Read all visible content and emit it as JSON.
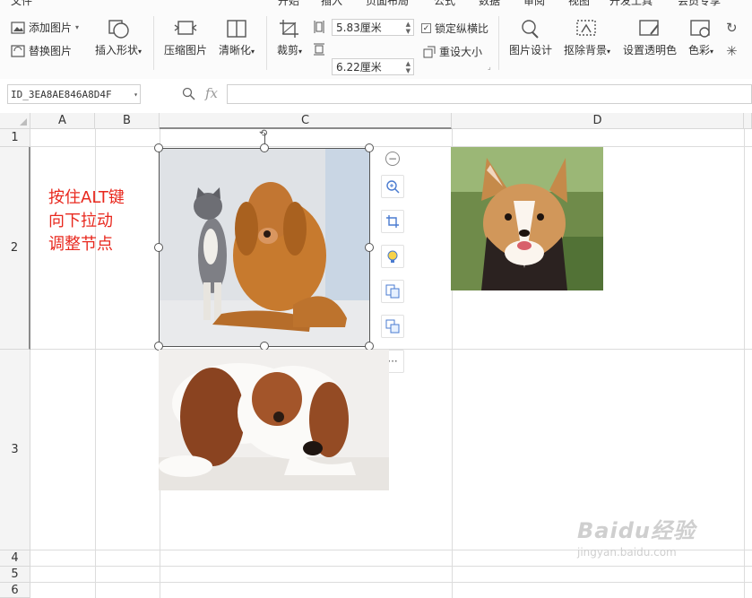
{
  "ribbon": {
    "tabs": [
      "文件",
      "开始",
      "插入",
      "页面布局",
      "公式",
      "数据",
      "审阅",
      "视图",
      "开发工具",
      "会员专享"
    ],
    "add_image": "添加图片",
    "replace_image": "替换图片",
    "insert_shape": "插入形状",
    "compress_image": "压缩图片",
    "sharpen": "清晰化",
    "crop": "裁剪",
    "height_value": "5.83厘米",
    "width_value": "6.22厘米",
    "lock_ratio": "锁定纵横比",
    "reset_size": "重设大小",
    "image_design": "图片设计",
    "remove_bg": "抠除背景",
    "set_transparent": "设置透明色",
    "color": "色彩",
    "lock_ratio_checked": true
  },
  "formula_bar": {
    "name_box": "ID_3EA8AE846A8D4F",
    "fx_label": "fx",
    "formula": ""
  },
  "grid": {
    "columns": [
      "A",
      "B",
      "C",
      "D"
    ],
    "rows": [
      "1",
      "2",
      "3",
      "4",
      "5",
      "6"
    ],
    "note_lines": [
      "按住ALT键",
      "向下拉动",
      "调整节点"
    ]
  },
  "images": [
    {
      "subject": "cat and golden retriever",
      "selected": true
    },
    {
      "subject": "corgi",
      "selected": false
    },
    {
      "subject": "cavalier spaniel",
      "selected": false
    }
  ],
  "float_toolbar": [
    "zoom-out-icon",
    "zoom-in-icon",
    "crop-icon",
    "idea-icon",
    "convert-icon",
    "layout-icon",
    "more-icon"
  ],
  "watermark": {
    "brand": "Baidu经验",
    "url": "jingyan.baidu.com"
  },
  "colors": {
    "note": "#e8281e",
    "grid": "#dcdcdc"
  }
}
